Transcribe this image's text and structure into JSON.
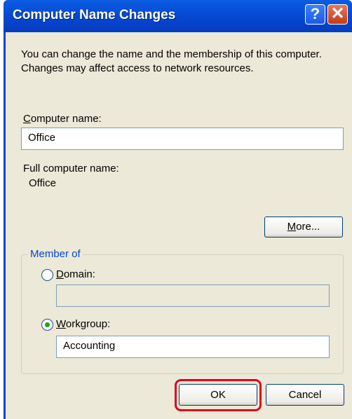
{
  "dialog": {
    "title": "Computer Name Changes",
    "description": "You can change the name and the membership of this computer. Changes may affect access to network resources."
  },
  "computer_name": {
    "label_access_key": "C",
    "label_rest": "omputer name:",
    "value": "Office"
  },
  "full_computer_name": {
    "label": "Full computer name:",
    "value": "Office"
  },
  "more_button": {
    "access_key": "M",
    "rest": "ore..."
  },
  "member_of": {
    "title": "Member of",
    "domain": {
      "access_key": "D",
      "rest": "omain:",
      "selected": false,
      "value": ""
    },
    "workgroup": {
      "access_key": "W",
      "rest": "orkgroup:",
      "selected": true,
      "value": "Accounting"
    }
  },
  "buttons": {
    "ok": "OK",
    "cancel": "Cancel"
  },
  "title_buttons": {
    "help": "?",
    "close": "✕"
  },
  "colors": {
    "titlebar": "#0747cf",
    "highlight": "#e2001a",
    "group_title": "#0046d5"
  }
}
